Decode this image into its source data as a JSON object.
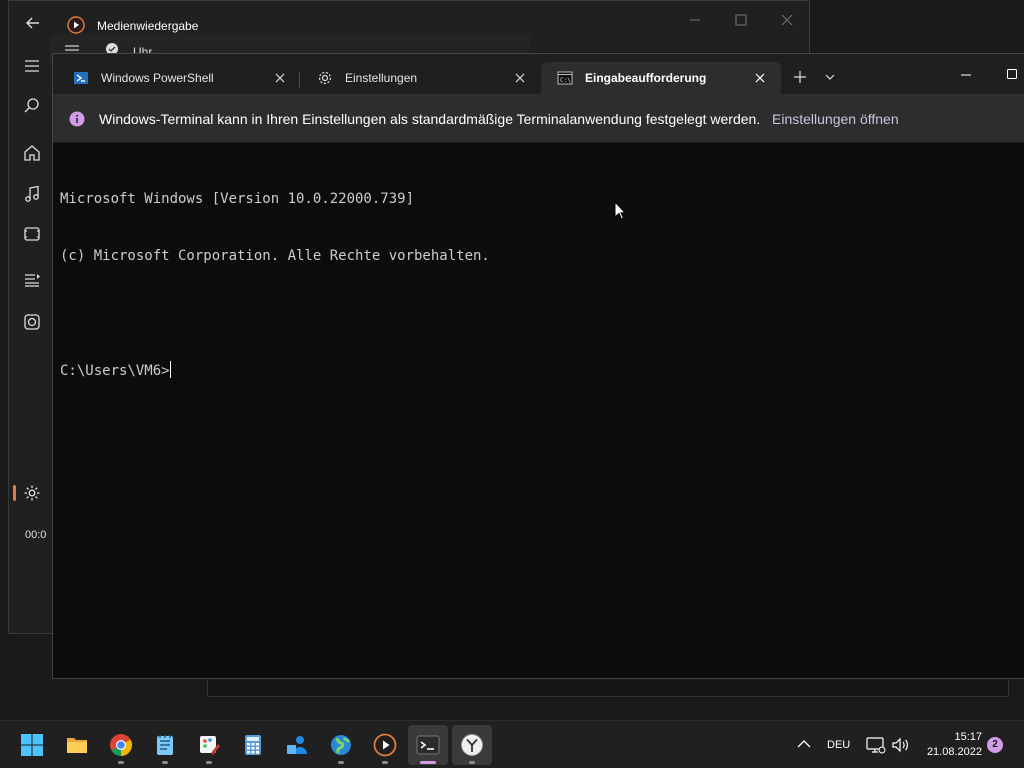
{
  "media_player": {
    "title": "Medienwiedergabe",
    "time_readout": "00:0"
  },
  "clock_app": {
    "title": "Uhr"
  },
  "terminal": {
    "tabs": [
      {
        "label": "Windows PowerShell",
        "icon": "powershell-icon",
        "active": false
      },
      {
        "label": "Einstellungen",
        "icon": "gear-icon",
        "active": false
      },
      {
        "label": "Eingabeaufforderung",
        "icon": "cmd-icon",
        "active": true
      }
    ],
    "infobar": {
      "message": "Windows-Terminal kann in Ihren Einstellungen als standardmäßige Terminalanwendung festgelegt werden.",
      "link": "Einstellungen öffnen"
    },
    "console_lines": [
      "Microsoft Windows [Version 10.0.22000.739]",
      "(c) Microsoft Corporation. Alle Rechte vorbehalten.",
      "",
      "C:\\Users\\VM6>"
    ]
  },
  "taskbar": {
    "apps": [
      {
        "name": "start-button",
        "icon": "windows-logo-icon"
      },
      {
        "name": "file-explorer-button",
        "icon": "folder-icon"
      },
      {
        "name": "chrome-button",
        "icon": "chrome-icon"
      },
      {
        "name": "notepad-button",
        "icon": "notepad-icon"
      },
      {
        "name": "paint-button",
        "icon": "paint-icon"
      },
      {
        "name": "calculator-button",
        "icon": "calculator-icon"
      },
      {
        "name": "people-button",
        "icon": "people-icon"
      },
      {
        "name": "maps-button",
        "icon": "globe-icon"
      },
      {
        "name": "media-player-button",
        "icon": "play-icon"
      },
      {
        "name": "terminal-button",
        "icon": "terminal-icon"
      },
      {
        "name": "clock-button",
        "icon": "clock-icon"
      }
    ],
    "tray": {
      "language": "DEU",
      "time": "15:17",
      "date": "21.08.2022",
      "notification_count": "2"
    }
  },
  "colors": {
    "accent": "#d29ce6",
    "terminal_bg": "#0c0c0c",
    "infobar_bg": "#2d2d2d",
    "media_accent": "#e07b3b"
  }
}
